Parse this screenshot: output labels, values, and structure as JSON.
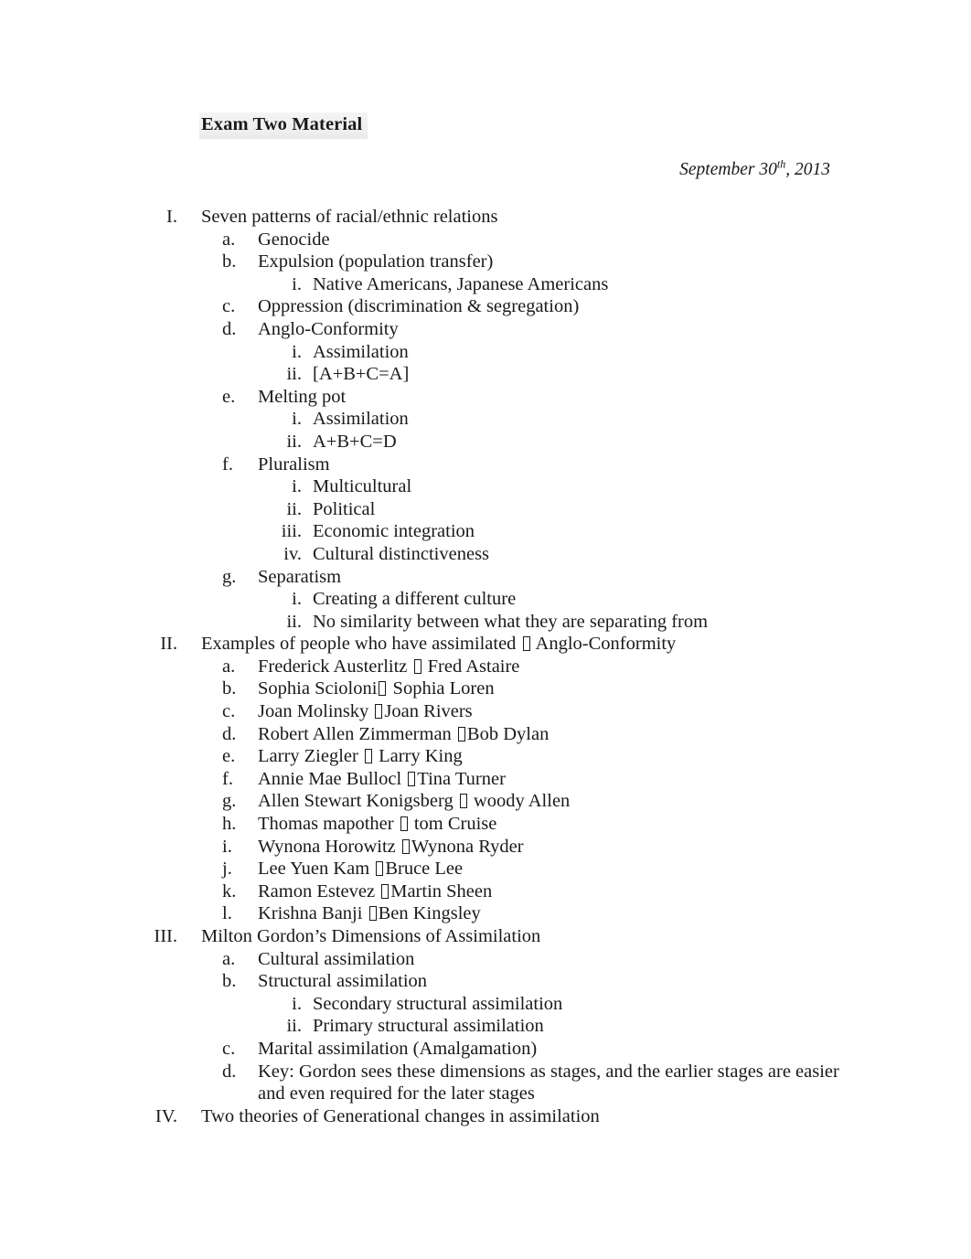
{
  "document": {
    "title": "Exam Two Material",
    "date_text": "September 30",
    "date_superscript": "th",
    "date_year": ", 2013",
    "arrow_glyph_name": "missing-glyph-box",
    "background_color": "#ffffff",
    "text_color": "#1a1a1a",
    "title_highlight_color": "#efefef"
  },
  "outline": [
    {
      "marker": "I.",
      "text": "Seven patterns of racial/ethnic relations",
      "children": [
        {
          "marker": "a.",
          "text": "Genocide",
          "children": []
        },
        {
          "marker": "b.",
          "text": "Expulsion (population transfer)",
          "children": [
            {
              "marker": "i.",
              "text": "Native Americans, Japanese Americans"
            }
          ]
        },
        {
          "marker": "c.",
          "text": "Oppression (discrimination & segregation)",
          "children": []
        },
        {
          "marker": "d.",
          "text": "Anglo-Conformity",
          "children": [
            {
              "marker": "i.",
              "text": "Assimilation"
            },
            {
              "marker": "ii.",
              "text": "[A+B+C=A]"
            }
          ]
        },
        {
          "marker": "e.",
          "text": "Melting pot",
          "children": [
            {
              "marker": "i.",
              "text": "Assimilation"
            },
            {
              "marker": "ii.",
              "text": "A+B+C=D"
            }
          ]
        },
        {
          "marker": "f.",
          "text": "Pluralism",
          "children": [
            {
              "marker": "i.",
              "text": "Multicultural"
            },
            {
              "marker": "ii.",
              "text": "Political"
            },
            {
              "marker": "iii.",
              "text": "Economic integration"
            },
            {
              "marker": "iv.",
              "text": "Cultural distinctiveness"
            }
          ]
        },
        {
          "marker": "g.",
          "text": "Separatism",
          "children": [
            {
              "marker": "i.",
              "text": "Creating a different culture"
            },
            {
              "marker": "ii.",
              "text": "No similarity between what they are separating from"
            }
          ]
        }
      ]
    },
    {
      "marker": "II.",
      "text_before_arrow": "Examples of people who have assimilated ",
      "text_after_arrow": " Anglo-Conformity",
      "has_arrow": true,
      "children": [
        {
          "marker": "a.",
          "text_before_arrow": "Frederick Austerlitz ",
          "text_after_arrow": " Fred Astaire",
          "has_arrow": true,
          "children": []
        },
        {
          "marker": "b.",
          "text_before_arrow": "Sophia Scioloni",
          "text_after_arrow": " Sophia Loren",
          "has_arrow": true,
          "children": []
        },
        {
          "marker": "c.",
          "text_before_arrow": "Joan Molinsky ",
          "text_after_arrow": "Joan Rivers",
          "has_arrow": true,
          "children": []
        },
        {
          "marker": "d.",
          "text_before_arrow": "Robert Allen Zimmerman ",
          "text_after_arrow": "Bob Dylan",
          "has_arrow": true,
          "children": []
        },
        {
          "marker": "e.",
          "text_before_arrow": "Larry Ziegler ",
          "text_after_arrow": " Larry King",
          "has_arrow": true,
          "children": []
        },
        {
          "marker": "f.",
          "text_before_arrow": "Annie Mae Bullocl ",
          "text_after_arrow": "Tina Turner",
          "has_arrow": true,
          "children": []
        },
        {
          "marker": "g.",
          "text_before_arrow": "Allen Stewart Konigsberg ",
          "text_after_arrow": " woody Allen",
          "has_arrow": true,
          "children": []
        },
        {
          "marker": "h.",
          "text_before_arrow": "Thomas mapother ",
          "text_after_arrow": " tom Cruise",
          "has_arrow": true,
          "children": []
        },
        {
          "marker": "i.",
          "text_before_arrow": "Wynona Horowitz ",
          "text_after_arrow": "Wynona Ryder",
          "has_arrow": true,
          "children": []
        },
        {
          "marker": "j.",
          "text_before_arrow": "Lee Yuen Kam ",
          "text_after_arrow": "Bruce Lee",
          "has_arrow": true,
          "children": []
        },
        {
          "marker": "k.",
          "text_before_arrow": "Ramon Estevez ",
          "text_after_arrow": "Martin Sheen",
          "has_arrow": true,
          "children": []
        },
        {
          "marker": "l.",
          "text_before_arrow": "Krishna Banji ",
          "text_after_arrow": "Ben Kingsley",
          "has_arrow": true,
          "children": []
        }
      ]
    },
    {
      "marker": "III.",
      "text": "Milton Gordon’s Dimensions of Assimilation",
      "children": [
        {
          "marker": "a.",
          "text": "Cultural assimilation",
          "children": []
        },
        {
          "marker": "b.",
          "text": "Structural assimilation",
          "children": [
            {
              "marker": "i.",
              "text": "Secondary structural assimilation"
            },
            {
              "marker": "ii.",
              "text": "Primary structural assimilation"
            }
          ]
        },
        {
          "marker": "c.",
          "text": "Marital assimilation (Amalgamation)",
          "children": []
        },
        {
          "marker": "d.",
          "text": "Key: Gordon sees these dimensions as stages, and the earlier stages are easier and even required for the later stages",
          "children": []
        }
      ]
    },
    {
      "marker": "IV.",
      "text": "Two theories of Generational changes in assimilation",
      "children": []
    }
  ]
}
